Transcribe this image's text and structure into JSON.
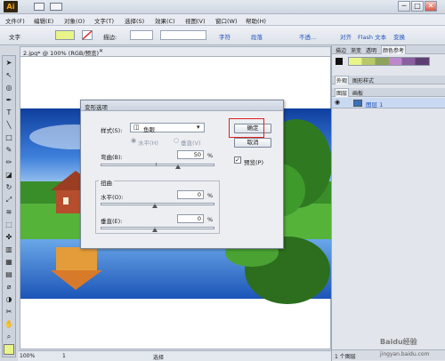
{
  "window": {
    "app_logo": "Ai",
    "min": "─",
    "max": "□",
    "close": "✕"
  },
  "menu": [
    "文件(F)",
    "编辑(E)",
    "对象(O)",
    "文字(T)",
    "选择(S)",
    "效果(C)",
    "视图(V)",
    "窗口(W)",
    "帮助(H)"
  ],
  "control": {
    "type_label": "文字",
    "stroke_label": "描边:",
    "char": "字符",
    "para": "段落",
    "opacity": "不透...",
    "align": "对齐",
    "flash_text": "Flash 文本",
    "transform": "变换"
  },
  "document": {
    "tab_title": "2.jpg* @ 100% (RGB/预览)",
    "tab_close": "✕"
  },
  "status": {
    "zoom": "100%",
    "page": "1",
    "mode": "选择"
  },
  "panels": {
    "top_tabs": [
      "描边",
      "渐变",
      "透明",
      "颜色参考"
    ],
    "appearance_tabs": [
      "外观",
      "图形样式"
    ],
    "layer_tabs": [
      "图层",
      "画板"
    ],
    "layer_name": "图层 1",
    "layer_count": "1 个图层"
  },
  "dialog": {
    "title": "变形选项",
    "style_label": "样式(S):",
    "style_value": "鱼眼",
    "horizontal_radio": "水平(H)",
    "vertical_radio": "垂直(V)",
    "bend_label": "弯曲(B):",
    "bend_value": "50",
    "bend_unit": "%",
    "bend_level": 0.75,
    "distortion_label": "扭曲",
    "horiz_label": "水平(O):",
    "horiz_value": "0",
    "horiz_unit": "%",
    "vert_label": "垂直(E):",
    "vert_value": "0",
    "vert_unit": "%",
    "ok": "确定",
    "cancel": "取消",
    "preview": "预览(P)",
    "preview_check": "✓"
  },
  "watermark": {
    "site": "Baidu经验",
    "url": "jingyan.baidu.com"
  },
  "colors": {
    "accent": "#1a4fc0",
    "highlight": "#e02020",
    "sky": "#1f5fc8"
  }
}
